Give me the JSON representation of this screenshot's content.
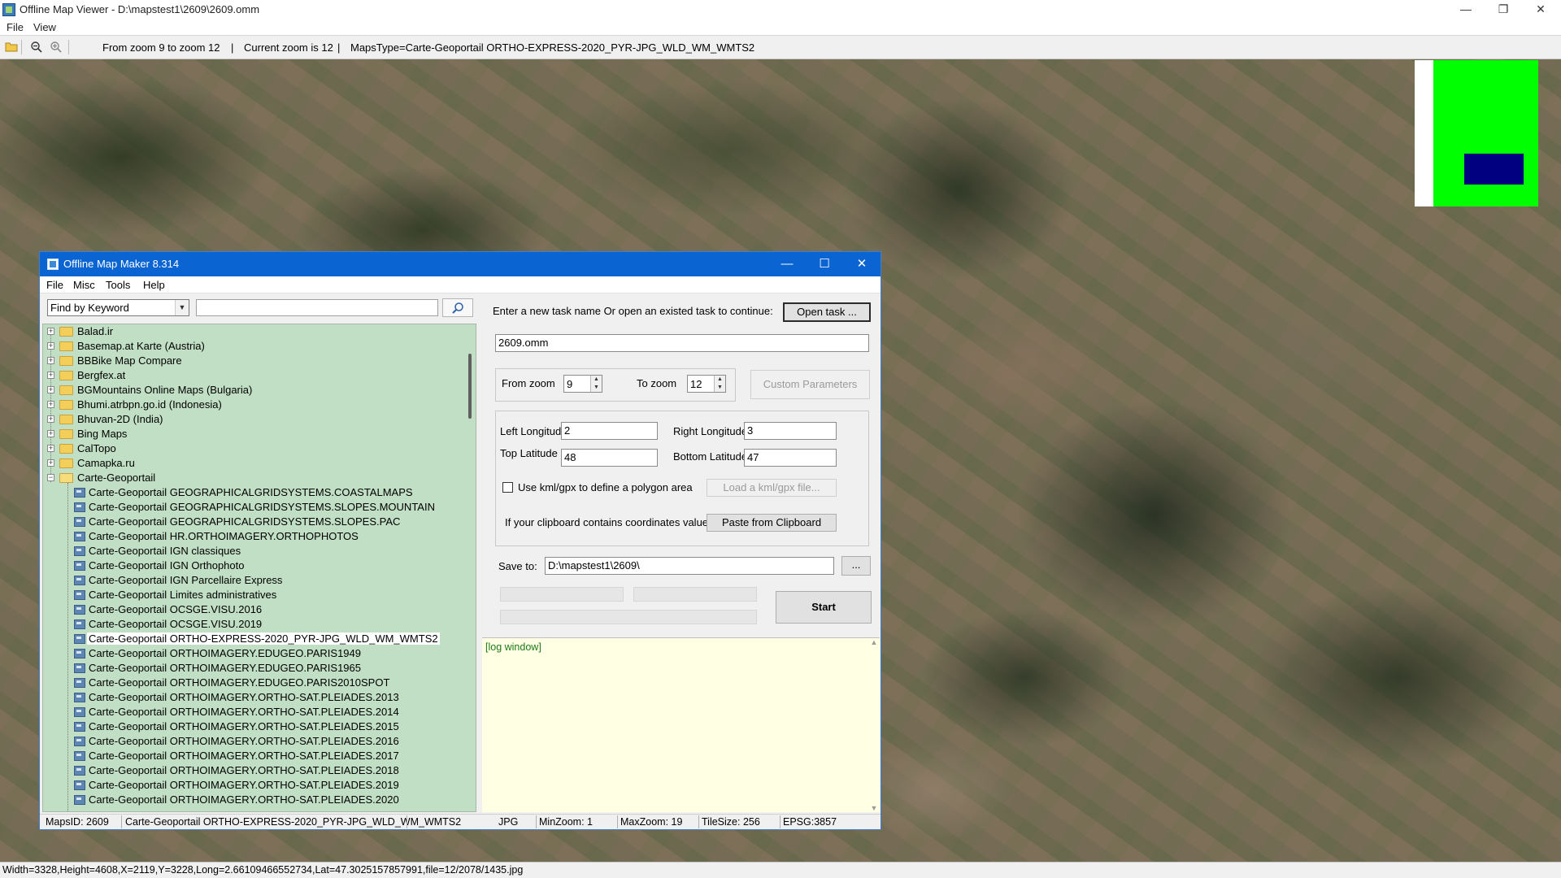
{
  "viewer": {
    "title": "Offline Map Viewer - D:\\mapstest1\\2609\\2609.omm",
    "window_controls": {
      "minimize": "—",
      "maximize": "❐",
      "close": "✕"
    },
    "menu": [
      "File",
      "View"
    ],
    "toolbar": {
      "zoom_range": "From zoom 9 to zoom 12",
      "sep1": "|",
      "current_zoom": "Current zoom is 12",
      "sep2": "|",
      "maps_type": "MapsType=Carte-Geoportail ORTHO-EXPRESS-2020_PYR-JPG_WLD_WM_WMTS2"
    },
    "status_bar": "Width=3328,Height=4608,X=2119,Y=3228,Long=2.66109466552734,Lat=47.3025157857991,file=12/2078/1435.jpg",
    "colors": {
      "minimap_bg": "#00ff00",
      "minimap_view": "#000080"
    }
  },
  "dialog": {
    "title": "Offline Map Maker 8.314",
    "window_controls": {
      "minimize": "—",
      "maximize": "☐",
      "close": "✕"
    },
    "menu": [
      "File",
      "Misc",
      "Tools",
      "Help"
    ],
    "find_mode": "Find by Keyword",
    "find_value": "",
    "tree": {
      "folders_collapsed": [
        "Balad.ir",
        "Basemap.at Karte (Austria)",
        "BBBike Map Compare",
        "Bergfex.at",
        "BGMountains Online Maps (Bulgaria)",
        "Bhumi.atrbpn.go.id (Indonesia)",
        "Bhuvan-2D (India)",
        "Bing Maps",
        "CalTopo",
        "Camapka.ru"
      ],
      "folder_expanded": "Carte-Geoportail",
      "children": [
        "Carte-Geoportail GEOGRAPHICALGRIDSYSTEMS.COASTALMAPS",
        "Carte-Geoportail GEOGRAPHICALGRIDSYSTEMS.SLOPES.MOUNTAIN",
        "Carte-Geoportail GEOGRAPHICALGRIDSYSTEMS.SLOPES.PAC",
        "Carte-Geoportail HR.ORTHOIMAGERY.ORTHOPHOTOS",
        "Carte-Geoportail IGN classiques",
        "Carte-Geoportail IGN Orthophoto",
        "Carte-Geoportail IGN Parcellaire Express",
        "Carte-Geoportail Limites administratives",
        "Carte-Geoportail OCSGE.VISU.2016",
        "Carte-Geoportail OCSGE.VISU.2019",
        "Carte-Geoportail ORTHO-EXPRESS-2020_PYR-JPG_WLD_WM_WMTS2",
        "Carte-Geoportail ORTHOIMAGERY.EDUGEO.PARIS1949",
        "Carte-Geoportail ORTHOIMAGERY.EDUGEO.PARIS1965",
        "Carte-Geoportail ORTHOIMAGERY.EDUGEO.PARIS2010SPOT",
        "Carte-Geoportail ORTHOIMAGERY.ORTHO-SAT.PLEIADES.2013",
        "Carte-Geoportail ORTHOIMAGERY.ORTHO-SAT.PLEIADES.2014",
        "Carte-Geoportail ORTHOIMAGERY.ORTHO-SAT.PLEIADES.2015",
        "Carte-Geoportail ORTHOIMAGERY.ORTHO-SAT.PLEIADES.2016",
        "Carte-Geoportail ORTHOIMAGERY.ORTHO-SAT.PLEIADES.2017",
        "Carte-Geoportail ORTHOIMAGERY.ORTHO-SAT.PLEIADES.2018",
        "Carte-Geoportail ORTHOIMAGERY.ORTHO-SAT.PLEIADES.2019",
        "Carte-Geoportail ORTHOIMAGERY.ORTHO-SAT.PLEIADES.2020"
      ],
      "selected": "Carte-Geoportail ORTHO-EXPRESS-2020_PYR-JPG_WLD_WM_WMTS2"
    },
    "task": {
      "prompt": "Enter a new task name Or open an existed task to continue:",
      "open_button": "Open task ...",
      "name": "2609.omm"
    },
    "zoom": {
      "from_label": "From zoom",
      "from_value": "9",
      "to_label": "To zoom",
      "to_value": "12",
      "custom_button": "Custom Parameters"
    },
    "coords": {
      "left_label": "Left Longitude",
      "left_value": "2",
      "right_label": "Right Longitude",
      "right_value": "3",
      "top_label": "Top Latitude",
      "top_value": "48",
      "bottom_label": "Bottom Latitude",
      "bottom_value": "47",
      "kml_checkbox": "Use kml/gpx to define a polygon area",
      "load_kml_button": "Load a kml/gpx file...",
      "clipboard_label": "If your clipboard contains coordinates values:",
      "paste_button": "Paste from Clipboard"
    },
    "save": {
      "label": "Save to:",
      "path": "D:\\mapstest1\\2609\\",
      "browse_button": "..."
    },
    "start_button": "Start",
    "log_text": "[log window]",
    "status": {
      "maps_id": "MapsID: 2609",
      "map_name": "Carte-Geoportail ORTHO-EXPRESS-2020_PYR-JPG_WLD_WM_WMTS2",
      "format": "JPG",
      "min_zoom": "MinZoom: 1",
      "max_zoom": "MaxZoom: 19",
      "tile_size": "TileSize: 256",
      "epsg": "EPSG:3857"
    }
  }
}
